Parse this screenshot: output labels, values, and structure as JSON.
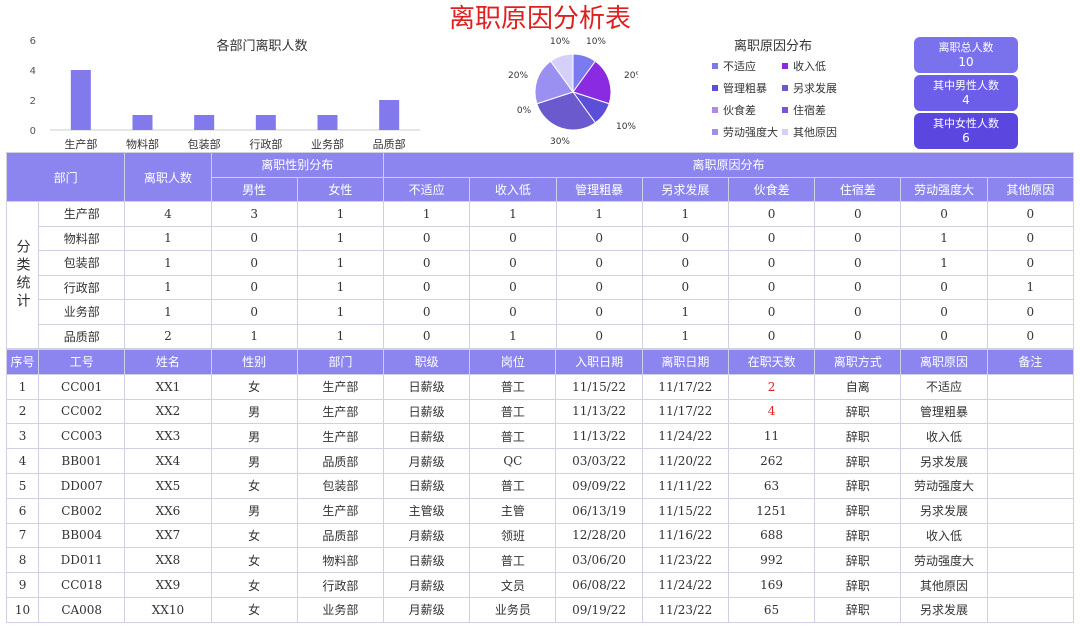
{
  "title": "离职原因分析表",
  "colors": {
    "header_bg": "#8c85f0",
    "bar": "#8279ec",
    "kpi1": "#7a72ec",
    "kpi2": "#6c5ee8",
    "kpi3": "#5b47e0",
    "red": "#e02020"
  },
  "chart_data": [
    {
      "type": "bar",
      "title": "各部门离职人数",
      "categories": [
        "生产部",
        "物料部",
        "包装部",
        "行政部",
        "业务部",
        "品质部"
      ],
      "values": [
        4,
        1,
        1,
        1,
        1,
        2
      ],
      "yticks": [
        0,
        2,
        4,
        6
      ],
      "ylim": [
        0,
        6
      ],
      "grid": false
    },
    {
      "type": "pie",
      "title": "离职原因分布",
      "labels": [
        "不适应",
        "收入低",
        "管理粗暴",
        "另求发展",
        "伙食差",
        "住宿差",
        "劳动强度大",
        "其他原因"
      ],
      "values": [
        10,
        20,
        10,
        30,
        0,
        0,
        20,
        10
      ],
      "value_labels": [
        "10%",
        "20%",
        "10%",
        "30%",
        "0%",
        "0%",
        "20%",
        "10%"
      ],
      "colors": [
        "#7b7bf0",
        "#8a2be2",
        "#5b4fd8",
        "#6a5acd",
        "#b388e8",
        "#7b52e0",
        "#9a90f2",
        "#d4d0fa"
      ],
      "legend_position": "right"
    }
  ],
  "kpis": [
    {
      "label": "离职总人数",
      "value": "10"
    },
    {
      "label": "其中男性人数",
      "value": "4"
    },
    {
      "label": "其中女性人数",
      "value": "6"
    }
  ],
  "summary": {
    "col_dept": "部门",
    "col_count": "离职人数",
    "group_gender": "离职性别分布",
    "group_reason": "离职原因分布",
    "gender_cols": [
      "男性",
      "女性"
    ],
    "reason_cols": [
      "不适应",
      "收入低",
      "管理粗暴",
      "另求发展",
      "伙食差",
      "住宿差",
      "劳动强度大",
      "其他原因"
    ],
    "side_label": "分类统计",
    "rows": [
      {
        "dept": "生产部",
        "count": "4",
        "male": "3",
        "female": "1",
        "reasons": [
          "1",
          "1",
          "1",
          "1",
          "0",
          "0",
          "0",
          "0"
        ]
      },
      {
        "dept": "物料部",
        "count": "1",
        "male": "0",
        "female": "1",
        "reasons": [
          "0",
          "0",
          "0",
          "0",
          "0",
          "0",
          "1",
          "0"
        ]
      },
      {
        "dept": "包装部",
        "count": "1",
        "male": "0",
        "female": "1",
        "reasons": [
          "0",
          "0",
          "0",
          "0",
          "0",
          "0",
          "1",
          "0"
        ]
      },
      {
        "dept": "行政部",
        "count": "1",
        "male": "0",
        "female": "1",
        "reasons": [
          "0",
          "0",
          "0",
          "0",
          "0",
          "0",
          "0",
          "1"
        ]
      },
      {
        "dept": "业务部",
        "count": "1",
        "male": "0",
        "female": "1",
        "reasons": [
          "0",
          "0",
          "0",
          "1",
          "0",
          "0",
          "0",
          "0"
        ]
      },
      {
        "dept": "品质部",
        "count": "2",
        "male": "1",
        "female": "1",
        "reasons": [
          "0",
          "1",
          "0",
          "1",
          "0",
          "0",
          "0",
          "0"
        ]
      }
    ]
  },
  "detail": {
    "headers": [
      "序号",
      "工号",
      "姓名",
      "性别",
      "部门",
      "职级",
      "岗位",
      "入职日期",
      "离职日期",
      "在职天数",
      "离职方式",
      "离职原因",
      "备注"
    ],
    "rows": [
      [
        "1",
        "CC001",
        "XX1",
        "女",
        "生产部",
        "日薪级",
        "普工",
        "11/15/22",
        "11/17/22",
        "2",
        "自离",
        "不适应",
        ""
      ],
      [
        "2",
        "CC002",
        "XX2",
        "男",
        "生产部",
        "日薪级",
        "普工",
        "11/13/22",
        "11/17/22",
        "4",
        "辞职",
        "管理粗暴",
        ""
      ],
      [
        "3",
        "CC003",
        "XX3",
        "男",
        "生产部",
        "日薪级",
        "普工",
        "11/13/22",
        "11/24/22",
        "11",
        "辞职",
        "收入低",
        ""
      ],
      [
        "4",
        "BB001",
        "XX4",
        "男",
        "品质部",
        "月薪级",
        "QC",
        "03/03/22",
        "11/20/22",
        "262",
        "辞职",
        "另求发展",
        ""
      ],
      [
        "5",
        "DD007",
        "XX5",
        "女",
        "包装部",
        "日薪级",
        "普工",
        "09/09/22",
        "11/11/22",
        "63",
        "辞职",
        "劳动强度大",
        ""
      ],
      [
        "6",
        "CB002",
        "XX6",
        "男",
        "生产部",
        "主管级",
        "主管",
        "06/13/19",
        "11/15/22",
        "1251",
        "辞职",
        "另求发展",
        ""
      ],
      [
        "7",
        "BB004",
        "XX7",
        "女",
        "品质部",
        "月薪级",
        "领班",
        "12/28/20",
        "11/16/22",
        "688",
        "辞职",
        "收入低",
        ""
      ],
      [
        "8",
        "DD011",
        "XX8",
        "女",
        "物料部",
        "日薪级",
        "普工",
        "03/06/20",
        "11/23/22",
        "992",
        "辞职",
        "劳动强度大",
        ""
      ],
      [
        "9",
        "CC018",
        "XX9",
        "女",
        "行政部",
        "月薪级",
        "文员",
        "06/08/22",
        "11/24/22",
        "169",
        "辞职",
        "其他原因",
        ""
      ],
      [
        "10",
        "CA008",
        "XX10",
        "女",
        "业务部",
        "月薪级",
        "业务员",
        "09/19/22",
        "11/23/22",
        "65",
        "辞职",
        "另求发展",
        ""
      ]
    ],
    "highlight_days": [
      "2",
      "4"
    ]
  }
}
